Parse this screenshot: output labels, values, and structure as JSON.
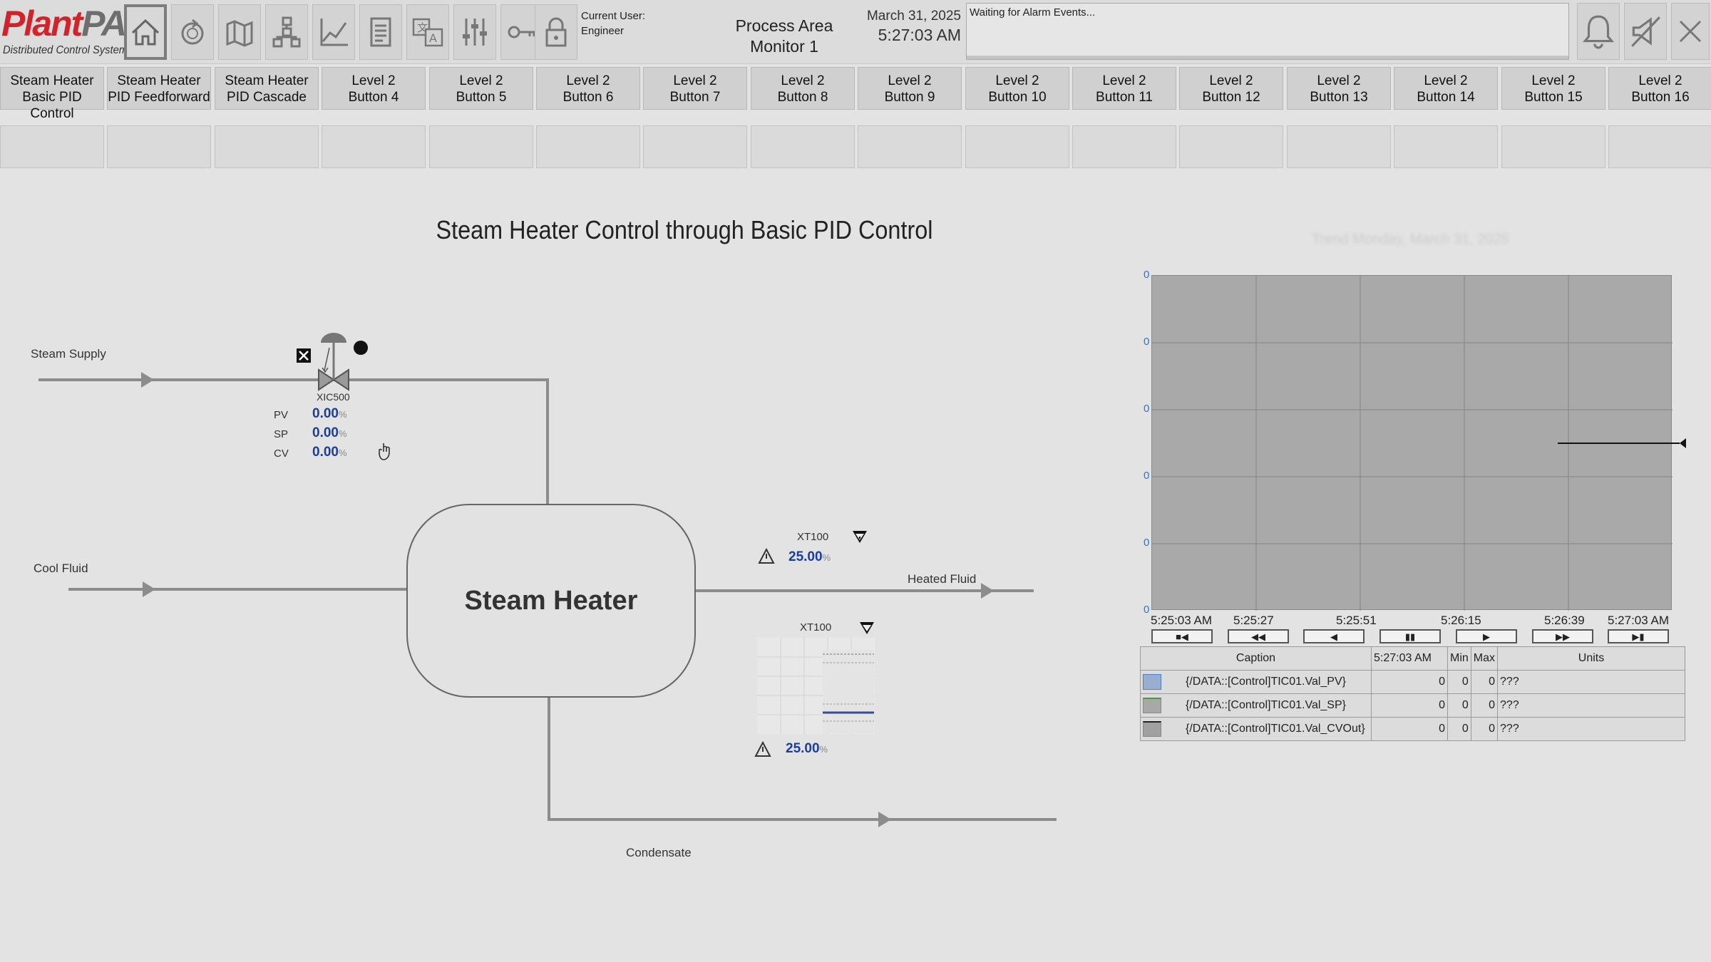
{
  "header": {
    "logo": {
      "brand_red": "Plant",
      "brand_gray": "PAx",
      "tagline": "Distributed Control System"
    },
    "toolbar_icons": [
      "home-icon",
      "refresh-icon",
      "map-icon",
      "hierarchy-icon",
      "trend-icon",
      "document-icon",
      "language-icon",
      "sliders-icon",
      "key-icon",
      "lock-icon"
    ],
    "current_user_label": "Current User:",
    "current_user": "Engineer",
    "area_title_line1": "Process Area",
    "area_title_line2": "Monitor 1",
    "date": "March 31, 2025",
    "time": "5:27:03 AM",
    "alarm_text": "Waiting for Alarm Events...",
    "right_icons": [
      "bell-icon",
      "silence-horn-icon",
      "close-icon"
    ]
  },
  "nav": [
    {
      "line1": "Steam Heater",
      "line2": "Basic PID Control"
    },
    {
      "line1": "Steam Heater",
      "line2": "PID Feedforward"
    },
    {
      "line1": "Steam Heater",
      "line2": "PID Cascade"
    },
    {
      "line1": "Level 2",
      "line2": "Button 4"
    },
    {
      "line1": "Level 2",
      "line2": "Button 5"
    },
    {
      "line1": "Level 2",
      "line2": "Button 6"
    },
    {
      "line1": "Level 2",
      "line2": "Button 7"
    },
    {
      "line1": "Level 2",
      "line2": "Button 8"
    },
    {
      "line1": "Level 2",
      "line2": "Button 9"
    },
    {
      "line1": "Level 2",
      "line2": "Button 10"
    },
    {
      "line1": "Level 2",
      "line2": "Button 11"
    },
    {
      "line1": "Level 2",
      "line2": "Button 12"
    },
    {
      "line1": "Level 2",
      "line2": "Button 13"
    },
    {
      "line1": "Level 2",
      "line2": "Button 14"
    },
    {
      "line1": "Level 2",
      "line2": "Button 15"
    },
    {
      "line1": "Level 2",
      "line2": "Button 16"
    }
  ],
  "process": {
    "title": "Steam Heater Control through Basic PID Control",
    "steam_supply": "Steam Supply",
    "cool_fluid": "Cool Fluid",
    "heated_fluid": "Heated Fluid",
    "condensate": "Condensate",
    "heater_label": "Steam Heater",
    "valve_tag": "XIC500",
    "pv_label": "PV",
    "pv_value": "0.00",
    "sp_label": "SP",
    "sp_value": "0.00",
    "cv_label": "CV",
    "cv_value": "0.00",
    "unit": "%",
    "xt1_tag": "XT100",
    "xt1_value": "25.00",
    "xt2_tag": "XT100",
    "xt2_value": "25.00"
  },
  "trend": {
    "title": "Trend     Monday, March 31, 2025",
    "y_ticks": [
      "0",
      "0",
      "0",
      "0",
      "0",
      "0"
    ],
    "x_ticks": [
      "5:25:03 AM",
      "5:25:27",
      "5:25:51",
      "5:26:15",
      "5:26:39",
      "5:27:03 AM"
    ],
    "playback": [
      "■◀",
      "◀◀",
      "◀",
      "▮▮",
      "▶",
      "▶▶",
      "▶▮"
    ],
    "table_headers": [
      "Caption",
      "5:27:03 AM",
      "Min",
      "Max",
      "Units"
    ],
    "pens": [
      {
        "caption": "{/DATA::[Control]TIC01.Val_PV}",
        "value": "0",
        "min": "0",
        "max": "0",
        "units": "???",
        "color": "#4a7fcf"
      },
      {
        "caption": "{/DATA::[Control]TIC01.Val_SP}",
        "value": "0",
        "min": "0",
        "max": "0",
        "units": "???",
        "color": "#4a9a3a"
      },
      {
        "caption": "{/DATA::[Control]TIC01.Val_CVOut}",
        "value": "0",
        "min": "0",
        "max": "0",
        "units": "???",
        "color": "#222222"
      }
    ]
  }
}
